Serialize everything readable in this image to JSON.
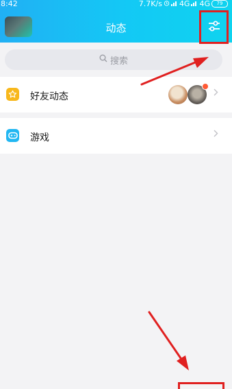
{
  "status_bar": {
    "time": "8:42",
    "network_speed": "7.7K/s",
    "signal_1": "4G",
    "signal_2": "4G",
    "battery": "79"
  },
  "header": {
    "title": "动态"
  },
  "search": {
    "placeholder": "搜索"
  },
  "list": [
    {
      "label": "好友动态",
      "icon": "star-icon",
      "icon_color": "#f8b81c",
      "has_new_badge": true
    },
    {
      "label": "游戏",
      "icon": "gamepad-icon",
      "icon_color": "#22b7f2"
    }
  ],
  "colors": {
    "header_gradient_start": "#21b0f4",
    "header_gradient_end": "#0fd3ef",
    "annotation_red": "#e02020",
    "background": "#f3f3f5"
  }
}
